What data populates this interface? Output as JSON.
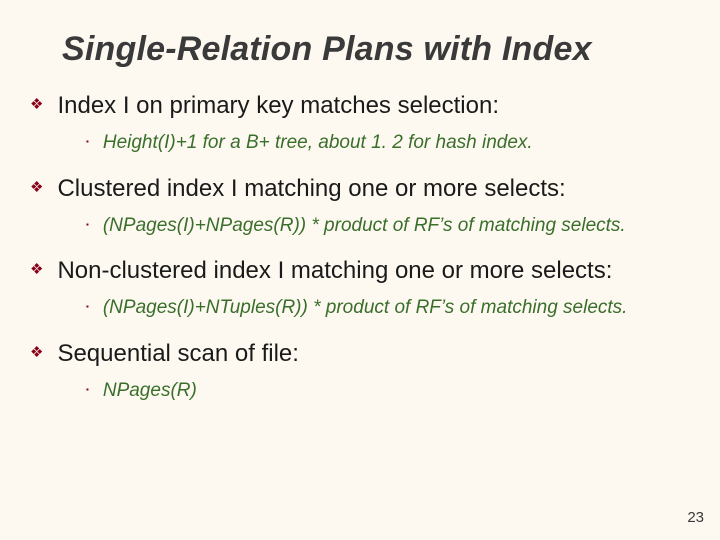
{
  "title": "Single-Relation Plans with Index",
  "points": [
    {
      "text": "Index I on primary key matches selection:",
      "sub": "Height(I)+1 for a B+ tree, about 1. 2 for hash index."
    },
    {
      "text": "Clustered index I matching one or more selects:",
      "sub": "(NPages(I)+NPages(R)) * product of RF’s of matching selects."
    },
    {
      "text": "Non-clustered index I matching one or more selects:",
      "sub": "(NPages(I)+NTuples(R)) * product of RF’s of matching selects."
    },
    {
      "text": "Sequential scan of file:",
      "sub": "NPages(R)"
    }
  ],
  "page_number": "23",
  "glyphs": {
    "diamond": "❖",
    "square": "▪"
  }
}
